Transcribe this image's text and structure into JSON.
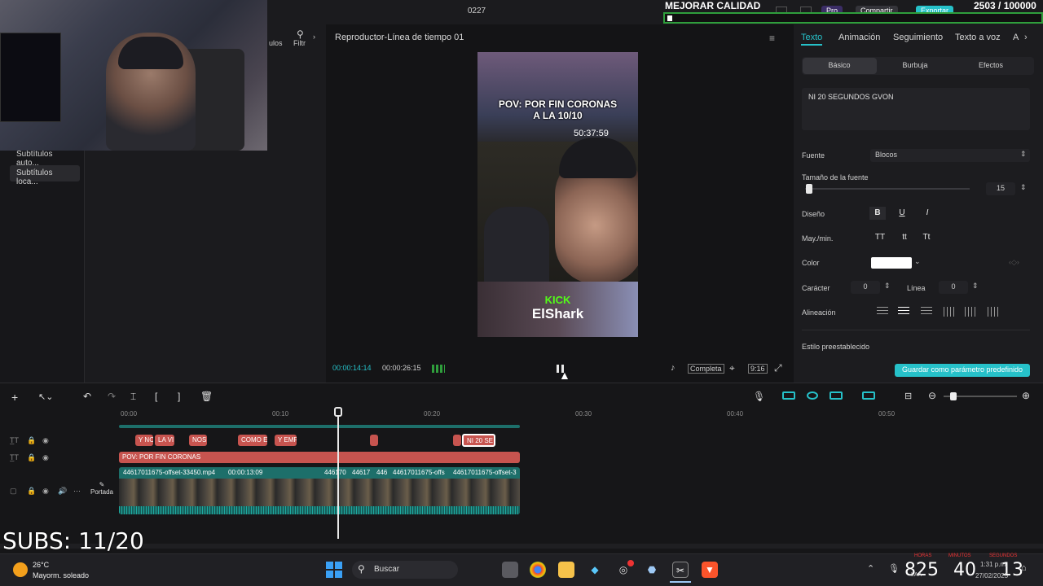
{
  "topbar": {
    "title": "0227",
    "mejorar": "MEJORAR CALIDAD",
    "subgoal": "2503 / 100000",
    "pro": "Pro",
    "compartir": "Compartir",
    "exportar": "Exportar",
    "left_tabs": [
      "ulos",
      "Filtr"
    ]
  },
  "left_panel": {
    "items": [
      "Subtítulos auto...",
      "Subtítulos loca..."
    ]
  },
  "player": {
    "title": "Reproductor-Línea de tiempo 01",
    "overlay_line1": "POV: POR FIN CORONAS",
    "overlay_line2": "A LA 10/10",
    "clock": "50:37:59",
    "kick": "KICK",
    "elshark": "ElShark",
    "time_current": "00:00:14:14",
    "time_total": "00:00:26:15",
    "completa": "Completa",
    "ratio": "9:16"
  },
  "right_panel": {
    "tabs": [
      "Texto",
      "Animación",
      "Seguimiento",
      "Texto a voz",
      "A"
    ],
    "subtabs": [
      "Básico",
      "Burbuja",
      "Efectos"
    ],
    "text_value": "NI 20 SEGUNDOS GVON",
    "fuente_label": "Fuente",
    "fuente_value": "Blocos",
    "tamano_label": "Tamaño de la fuente",
    "tamano_value": "15",
    "diseno_label": "Diseño",
    "diseno_buttons": [
      "B",
      "U",
      "I"
    ],
    "mayus_label": "May./min.",
    "mayus_buttons": [
      "TT",
      "tt",
      "Tt"
    ],
    "color_label": "Color",
    "color_value": "#ffffff",
    "caracter_label": "Carácter",
    "caracter_value": "0",
    "linea_label": "Línea",
    "linea_value": "0",
    "alineacion_label": "Alineación",
    "estilo_label": "Estilo preestablecido",
    "save_label": "Guardar como parámetro predefinido"
  },
  "timeline": {
    "ticks": [
      "00:00",
      "00:10",
      "00:20",
      "00:30",
      "00:40",
      "00:50"
    ],
    "text_clips": [
      "Y NC",
      "LA VI",
      "NOS",
      "COMO E",
      "Y EMF",
      "",
      "NI 20 SE"
    ],
    "pov_clip": "POV: POR FIN CORONAS",
    "video_label_1": "44617011675-offset-33450.mp4",
    "video_label_1_dur": "00:00:13:09",
    "video_label_2": "446170",
    "video_label_3": "44617",
    "video_label_4": "446",
    "video_label_5": "44617011675-offs",
    "video_label_6": "44617011675-offset-3",
    "portada": "Portada"
  },
  "overlay": {
    "subs": "SUBS: 11/20",
    "big_nums": [
      "825",
      "40",
      "13"
    ],
    "small_labels": [
      "HORAS",
      "MINUTOS",
      "SEGUNDOS"
    ]
  },
  "taskbar": {
    "temp": "26°C",
    "weather": "Mayorm. soleado",
    "search": "Buscar",
    "lang": "LAA",
    "time": "1:31 p.m.",
    "date": "27/02/2025"
  },
  "colors": {
    "accent": "#26c1c9",
    "clip_text": "#c7544f",
    "kick_green": "#53fc18"
  }
}
